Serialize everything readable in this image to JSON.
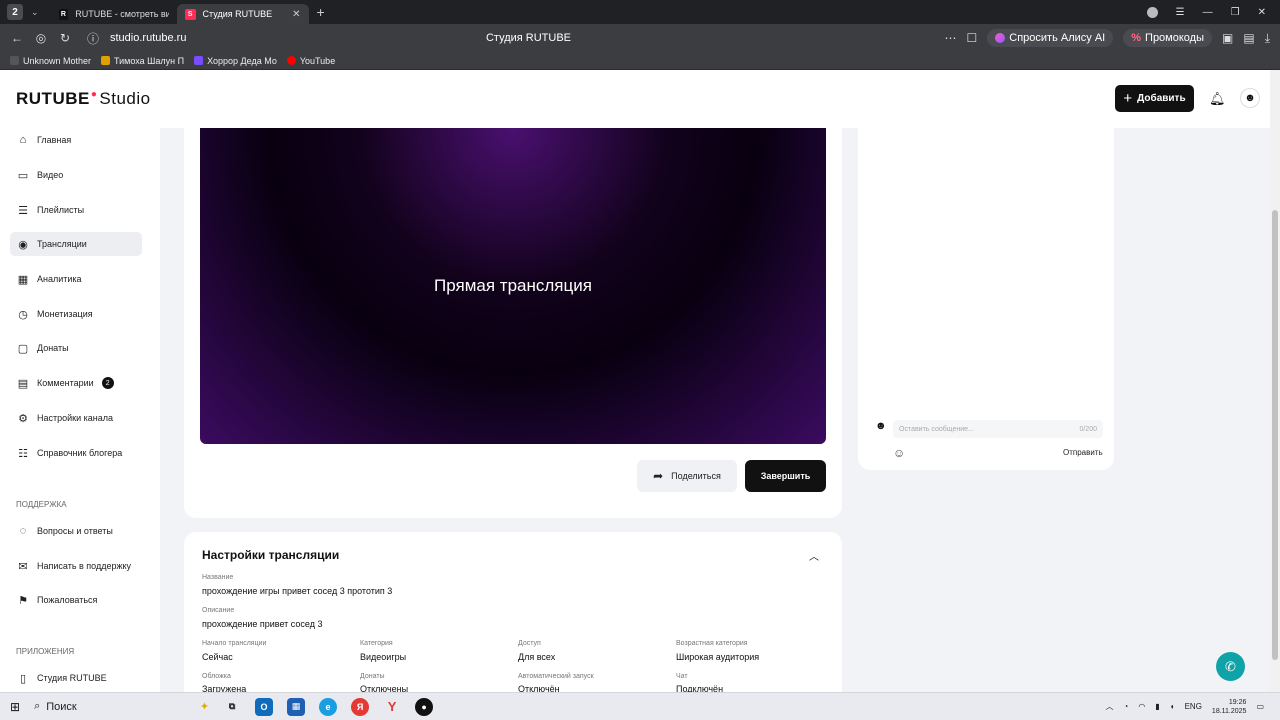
{
  "browser": {
    "tab_count": "2",
    "tabs": [
      {
        "label": "RUTUBE - смотреть виде",
        "favicon": "R",
        "color": "#111111"
      },
      {
        "label": "Студия RUTUBE",
        "favicon": "S",
        "color": "#ff2d55"
      }
    ],
    "url": "studio.rutube.ru",
    "page_title": "Студия RUTUBE",
    "alisa_label": "Спросить Алису AI",
    "promo_label": "Промокоды",
    "bookmarks": [
      {
        "label": "Unknown Mother",
        "color": "#555555"
      },
      {
        "label": "Тимоха Шалун П",
        "color": "#e0a000"
      },
      {
        "label": "Хоррор Деда Мо",
        "color": "#7a4cff"
      },
      {
        "label": "YouTube",
        "color": "#ff0000"
      }
    ]
  },
  "header": {
    "logo_main": "RUTUBE",
    "logo_suffix": "Studio",
    "add_label": "Добавить"
  },
  "sidebar": {
    "items": [
      {
        "label": "Главная",
        "icon": "home-icon",
        "glyph": "⌂"
      },
      {
        "label": "Видео",
        "icon": "video-icon",
        "glyph": "▭"
      },
      {
        "label": "Плейлисты",
        "icon": "playlist-icon",
        "glyph": "☰"
      },
      {
        "label": "Трансляции",
        "icon": "broadcast-icon",
        "glyph": "◉"
      },
      {
        "label": "Аналитика",
        "icon": "analytics-icon",
        "glyph": "▦"
      },
      {
        "label": "Монетизация",
        "icon": "monetization-icon",
        "glyph": "◷"
      },
      {
        "label": "Донаты",
        "icon": "donation-icon",
        "glyph": "▢"
      },
      {
        "label": "Комментарии",
        "icon": "comments-icon",
        "glyph": "▤",
        "badge": "2"
      },
      {
        "label": "Настройки канала",
        "icon": "settings-icon",
        "glyph": "⚙"
      },
      {
        "label": "Справочник блогера",
        "icon": "handbook-icon",
        "glyph": "☷"
      }
    ],
    "support_title": "Поддержка",
    "support_items": [
      {
        "label": "Вопросы и ответы",
        "icon": "faq-icon",
        "glyph": "◌"
      },
      {
        "label": "Написать в поддержку",
        "icon": "mail-icon",
        "glyph": "✉"
      },
      {
        "label": "Пожаловаться",
        "icon": "flag-icon",
        "glyph": "⚑"
      }
    ],
    "apps_title": "Приложения",
    "apps_items": [
      {
        "label": "Студия RUTUBE",
        "icon": "app-icon",
        "glyph": "▯"
      }
    ]
  },
  "player": {
    "overlay_text": "Прямая трансляция",
    "share_label": "Поделиться",
    "finish_label": "Завершить"
  },
  "chat": {
    "placeholder": "Оставить сообщение...",
    "counter": "0/200",
    "send_label": "Отправить"
  },
  "settings": {
    "title": "Настройки трансляции",
    "name_label": "Название",
    "name_value": "прохождение игры привет сосед 3 прототип 3",
    "desc_label": "Описание",
    "desc_value": "прохождение привет сосед 3",
    "fields": [
      {
        "label": "Начало трансляции",
        "value": "Сейчас"
      },
      {
        "label": "Категория",
        "value": "Видеоигры"
      },
      {
        "label": "Доступ",
        "value": "Для всех"
      },
      {
        "label": "Возрастная категория",
        "value": "Широкая аудитория"
      },
      {
        "label": "Обложка",
        "value": "Загружена"
      },
      {
        "label": "Донаты",
        "value": "Отключены"
      },
      {
        "label": "Автоматический запуск",
        "value": "Отключён"
      },
      {
        "label": "Чат",
        "value": "Подключён"
      }
    ]
  },
  "taskbar": {
    "search_label": "Поиск",
    "lang": "ENG",
    "time": "19:26",
    "date": "18.11.2025"
  }
}
